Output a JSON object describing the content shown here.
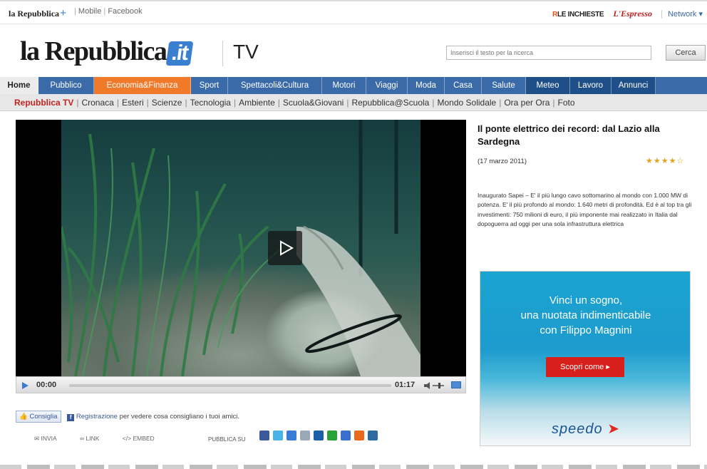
{
  "topbar": {
    "logo": "la Repubblica",
    "plus": "+",
    "links": [
      "Mobile",
      "Facebook"
    ],
    "inchieste_prefix": "R",
    "inchieste": "LE INCHIESTE",
    "espresso": "L'Espresso",
    "network": "Network ▾"
  },
  "header": {
    "logo_main": "la Repubblica",
    "logo_it": ".it",
    "section": "TV",
    "search_placeholder": "Inserisci il testo per la ricerca",
    "search_button": "Cerca"
  },
  "main_nav": [
    {
      "label": "Home",
      "bg": "#ececec",
      "color": "#222",
      "bold": true,
      "w": 54
    },
    {
      "label": "Pubblico",
      "bg": "#3a6aa8",
      "color": "#fff",
      "w": 78
    },
    {
      "label": "Economia&Finanza",
      "bg": "#f07a2a",
      "color": "#fff",
      "w": 136
    },
    {
      "label": "Sport",
      "bg": "#3a6aa8",
      "color": "#fff",
      "w": 52
    },
    {
      "label": "Spettacoli&Cultura",
      "bg": "#3a6aa8",
      "color": "#fff",
      "w": 132
    },
    {
      "label": "Motori",
      "bg": "#3a6aa8",
      "color": "#fff",
      "w": 62
    },
    {
      "label": "Viaggi",
      "bg": "#3a6aa8",
      "color": "#fff",
      "w": 58
    },
    {
      "label": "Moda",
      "bg": "#3a6aa8",
      "color": "#fff",
      "w": 52
    },
    {
      "label": "Casa",
      "bg": "#3a6aa8",
      "color": "#fff",
      "w": 52
    },
    {
      "label": "Salute",
      "bg": "#3a6aa8",
      "color": "#fff",
      "w": 62
    },
    {
      "label": "Meteo",
      "bg": "#1f4f88",
      "color": "#fff",
      "w": 62
    },
    {
      "label": "Lavoro",
      "bg": "#1f4f88",
      "color": "#fff",
      "w": 58
    },
    {
      "label": "Annunci",
      "bg": "#1f4f88",
      "color": "#fff",
      "w": 62
    }
  ],
  "sub_nav": [
    "Repubblica TV",
    "Cronaca",
    "Esteri",
    "Scienze",
    "Tecnologia",
    "Ambiente",
    "Scuola&Giovani",
    "Repubblica@Scuola",
    "Mondo Solidale",
    "Ora per Ora",
    "Foto"
  ],
  "player": {
    "time_current": "00:00",
    "time_total": "01:17"
  },
  "social": {
    "consiglia": "Consiglia",
    "registrazione": "Registrazione",
    "rest": " per vedere cosa consigliano i tuoi amici.",
    "share": [
      "INVIA",
      "LINK",
      "EMBED"
    ],
    "pubblica": "PUBBLICA SU",
    "icon_colors": [
      "#3b5998",
      "#4ab3e8",
      "#3a7bd5",
      "#9aa8b8",
      "#1a5fa8",
      "#2aa23a",
      "#3a6fd0",
      "#e86a1a",
      "#2e6b9e"
    ]
  },
  "article": {
    "title": "Il ponte elettrico dei record: dal Lazio alla Sardegna",
    "date": "(17 marzo 2011)",
    "rating": 4,
    "description": "Inaugurato Sapei – E' il più lungo cavo sottomarino al mondo con 1.000 MW di potenza. E' il più profondo al mondo: 1.640 metri di profondità. Ed è al top tra gli investimenti: 750 milioni di euro, il più imponente mai realizzato in Italia dal dopoguerra ad oggi per una sola infrastruttura elettrica"
  },
  "ad": {
    "line1": "Vinci un sogno,",
    "line2": "una nuotata indimenticabile",
    "line3": "con Filippo Magnini",
    "button": "Scopri come ▸",
    "brand": "speedo"
  }
}
